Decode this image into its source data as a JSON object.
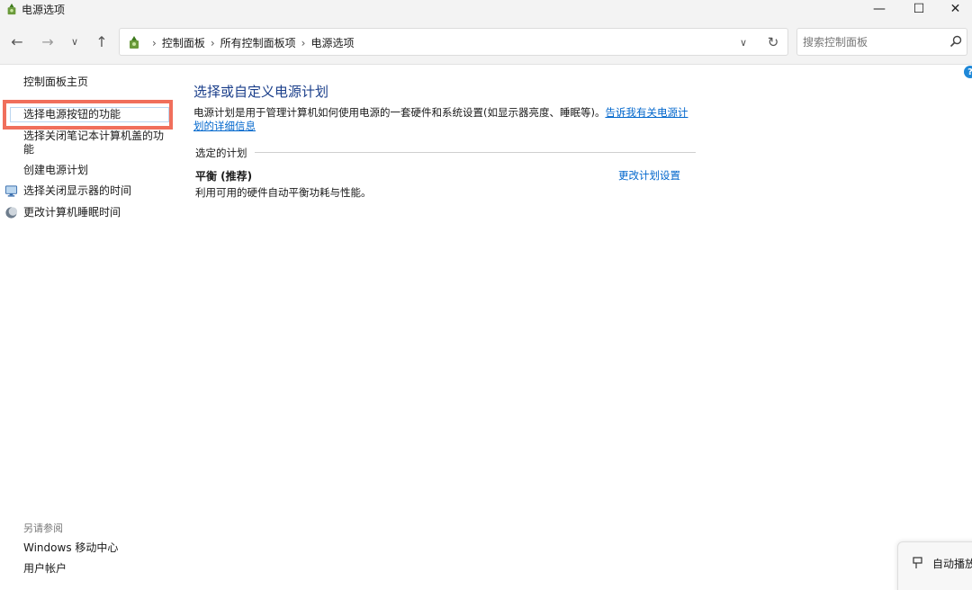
{
  "window": {
    "title": "电源选项",
    "minimize_glyph": "—",
    "maximize_glyph": "☐",
    "close_glyph": "✕"
  },
  "navigation": {
    "back_glyph": "←",
    "forward_glyph": "→",
    "recent_glyph": "∨",
    "up_glyph": "↑",
    "breadcrumbs": [
      "控制面板",
      "所有控制面板项",
      "电源选项"
    ],
    "separator": "›",
    "dropdown_glyph": "∨",
    "refresh_glyph": "↻"
  },
  "search": {
    "placeholder": "搜索控制面板"
  },
  "sidebar": {
    "home": "控制面板主页",
    "items": [
      {
        "label": "选择电源按钮的功能",
        "highlighted": true
      },
      {
        "label": "选择关闭笔记本计算机盖的功能"
      },
      {
        "label": "创建电源计划"
      },
      {
        "label": "选择关闭显示器的时间",
        "icon": "monitor-icon"
      },
      {
        "label": "更改计算机睡眠时间",
        "icon": "moon-icon"
      }
    ],
    "see_also_label": "另请参阅",
    "see_also": [
      {
        "label": "Windows 移动中心"
      },
      {
        "label": "用户帐户"
      }
    ]
  },
  "main": {
    "heading": "选择或自定义电源计划",
    "description": "电源计划是用于管理计算机如何使用电源的一套硬件和系统设置(如显示器亮度、睡眠等)。",
    "learn_more": "告诉我有关电源计划的详细信息",
    "section_label": "选定的计划",
    "plan": {
      "name": "平衡 (推荐)",
      "description": "利用可用的硬件自动平衡功耗与性能。",
      "change_link": "更改计划设置"
    }
  },
  "help": {
    "glyph": "?"
  },
  "toast": {
    "label": "自动播放"
  },
  "colors": {
    "link": "#0066cc",
    "heading": "#1a3e8a",
    "highlight_border": "#f06f5c",
    "chrome_bg": "#f3f3f3"
  }
}
